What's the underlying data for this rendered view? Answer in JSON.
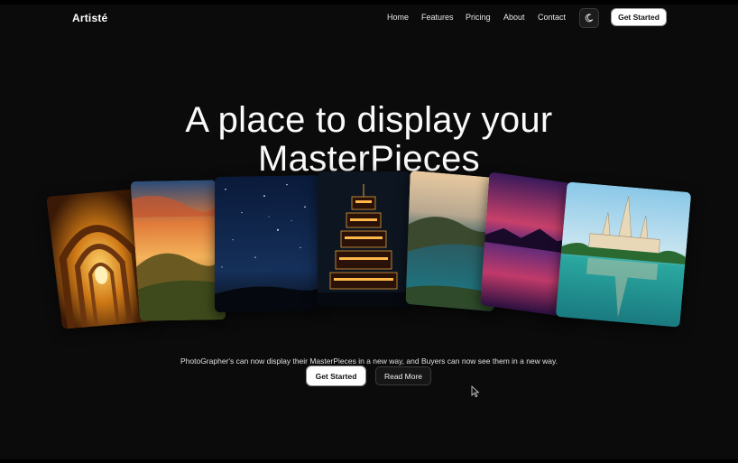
{
  "nav": {
    "brand": "Artisté",
    "links": [
      "Home",
      "Features",
      "Pricing",
      "About",
      "Contact"
    ],
    "theme_icon": "moon-icon",
    "cta_label": "Get Started"
  },
  "hero": {
    "title_line1": "A place to display your",
    "title_line2": "MasterPieces",
    "tagline": "PhotoGrapher's can now display their MasterPieces in a new way, and Buyers can now see them in a new way.",
    "primary_label": "Get Started",
    "secondary_label": "Read More"
  },
  "gallery": {
    "images": [
      "arched-corridor-photo",
      "sunset-hills-photo",
      "starry-night-photo",
      "pagoda-photo",
      "coastal-cliffs-photo",
      "purple-sunset-lake-photo",
      "temple-reflection-photo"
    ]
  },
  "colors": {
    "background": "#0b0b0b",
    "text": "#f2f2f2",
    "button_light": "#ffffff",
    "button_dark": "#161616"
  }
}
